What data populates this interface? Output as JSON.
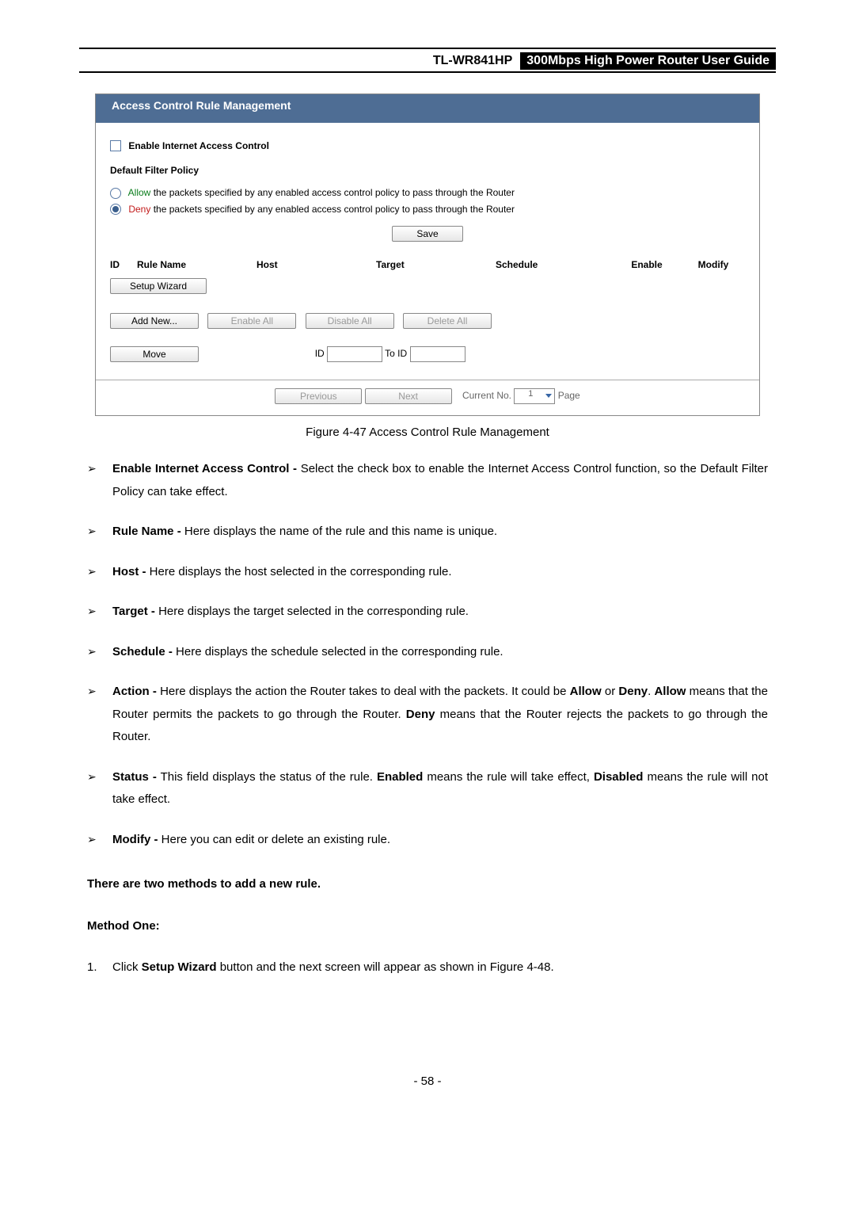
{
  "header": {
    "model": "TL-WR841HP",
    "title": "300Mbps High Power Router User Guide"
  },
  "shot": {
    "title": "Access Control Rule Management",
    "enable_label": "Enable Internet Access Control",
    "policy_heading": "Default Filter Policy",
    "allow_word": "Allow",
    "allow_rest": " the packets specified by any enabled access control policy to pass through the Router",
    "deny_word": "Deny",
    "deny_rest": " the packets specified by any enabled access control policy to pass through the Router",
    "save": "Save",
    "cols": {
      "id": "ID",
      "rule": "Rule Name",
      "host": "Host",
      "target": "Target",
      "schedule": "Schedule",
      "enable": "Enable",
      "modify": "Modify"
    },
    "setup_wizard": "Setup Wizard",
    "add_new": "Add New...",
    "enable_all": "Enable All",
    "disable_all": "Disable All",
    "delete_all": "Delete All",
    "move": "Move",
    "id_label": "ID",
    "to_id_label": "To ID",
    "prev": "Previous",
    "next": "Next",
    "current_no": "Current No.",
    "page_word": "Page",
    "page_value": "1"
  },
  "caption": "Figure 4-47    Access Control Rule Management",
  "bullets": [
    {
      "t": "Enable Internet Access Control -",
      "d": " Select the check box to enable the Internet Access Control function, so the Default Filter Policy can take effect."
    },
    {
      "t": "Rule Name -",
      "d": " Here displays the name of the rule and this name is unique."
    },
    {
      "t": "Host -",
      "d": " Here displays the host selected in the corresponding rule."
    },
    {
      "t": "Target -",
      "d": " Here displays the target selected in the corresponding rule."
    },
    {
      "t": "Schedule -",
      "d": " Here displays the schedule selected in the corresponding rule."
    },
    {
      "t": "Action -",
      "d": " Here displays the action the Router takes to deal with the packets. It could be ",
      "t2": "Allow",
      "d2": " or ",
      "t3": "Deny",
      "d3": ". ",
      "t4": "Allow",
      "d4": " means that the Router permits the packets to go through the Router. ",
      "t5": "Deny",
      "d5": " means that the Router rejects the packets to go through the Router."
    },
    {
      "t": "Status -",
      "d": " This field displays the status of the rule. ",
      "t2": "Enabled",
      "d2": " means the rule will take effect, ",
      "t3": "Disabled",
      "d3": " means the rule will not take effect."
    },
    {
      "t": "Modify -",
      "d": " Here you can edit or delete an existing rule."
    }
  ],
  "two_methods": "There are two methods to add a new rule.",
  "method_one": "Method One:",
  "step1_pre": "Click ",
  "step1_bold": "Setup Wizard",
  "step1_post": " button and the next screen will appear as shown in Figure 4-48.",
  "page_no": "- 58 -"
}
